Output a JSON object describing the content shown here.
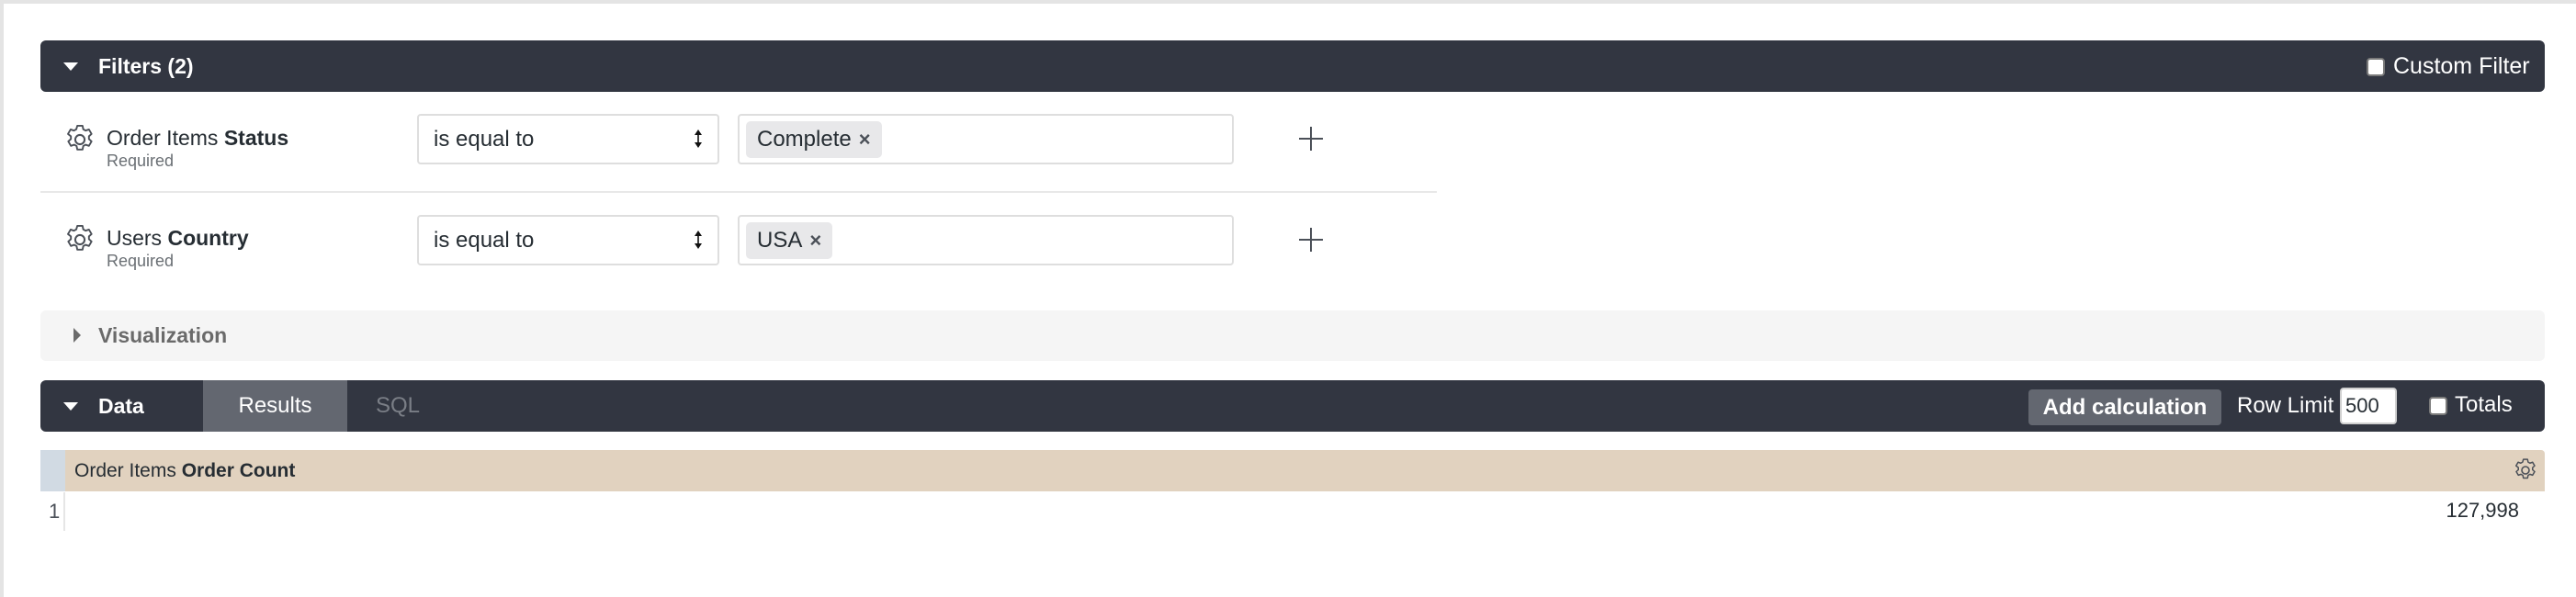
{
  "filters": {
    "title": "Filters (2)",
    "custom_filter_label": "Custom Filter",
    "custom_filter_checked": false,
    "rows": [
      {
        "field_prefix": "Order Items ",
        "field_name": "Status",
        "sub_label": "Required",
        "operator": "is equal to",
        "values": [
          "Complete"
        ],
        "remove_icon": "×"
      },
      {
        "field_prefix": "Users ",
        "field_name": "Country",
        "sub_label": "Required",
        "operator": "is equal to",
        "values": [
          "USA"
        ],
        "remove_icon": "×"
      }
    ]
  },
  "visualization": {
    "title": "Visualization"
  },
  "data": {
    "title": "Data",
    "tabs": [
      {
        "label": "Results",
        "active": true
      },
      {
        "label": "SQL",
        "active": false
      }
    ],
    "add_calculation_label": "Add calculation",
    "row_limit_label": "Row Limit",
    "row_limit_value": "500",
    "totals_label": "Totals",
    "totals_checked": false
  },
  "table": {
    "columns": [
      {
        "prefix": "Order Items ",
        "name": "Order Count"
      }
    ],
    "rows": [
      {
        "index": "1",
        "values": [
          "127,998"
        ]
      }
    ]
  },
  "colors": {
    "header_dark": "#323641",
    "active_tab": "#636770",
    "column_header": "#e1d2bf",
    "row_number_header": "#d1dae3",
    "visualization_bar": "#f5f5f5"
  }
}
